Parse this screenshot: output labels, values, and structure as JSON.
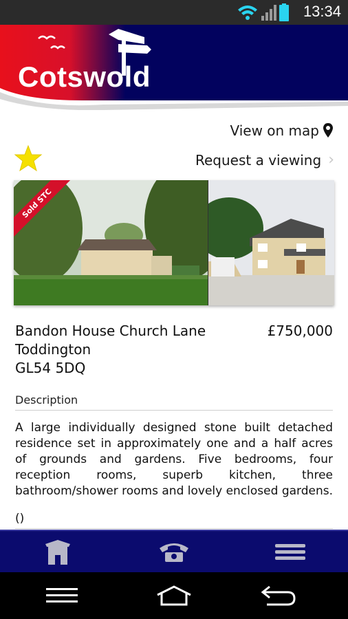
{
  "status_bar": {
    "time": "13:34",
    "icons": [
      "wifi-icon",
      "signal-icon",
      "battery-icon"
    ]
  },
  "header": {
    "logo_text": "Cotswold",
    "colors": {
      "red": "#e8101c",
      "navy": "#02025e"
    }
  },
  "actions": {
    "view_on_map": "View on map",
    "request_viewing": "Request a viewing"
  },
  "gallery": {
    "badge": "Sold STC"
  },
  "property": {
    "address_line1": "Bandon House Church Lane",
    "address_line2": "Toddington",
    "postcode": "GL54 5DQ",
    "price": "£750,000"
  },
  "description": {
    "heading": "Description",
    "body": "A large individually designed stone built detached residence set in approximately one and a half acres of grounds and gardens. Five bedrooms, four reception rooms, superb kitchen, three bathroom/shower rooms and lovely enclosed gardens.",
    "extra": "()"
  },
  "bottom_nav": {
    "items": [
      "home-icon",
      "phone-icon",
      "menu-icon"
    ],
    "color": "#0b0b6e"
  },
  "system_nav": {
    "items": [
      "recent-apps-icon",
      "home-icon",
      "back-icon"
    ]
  }
}
